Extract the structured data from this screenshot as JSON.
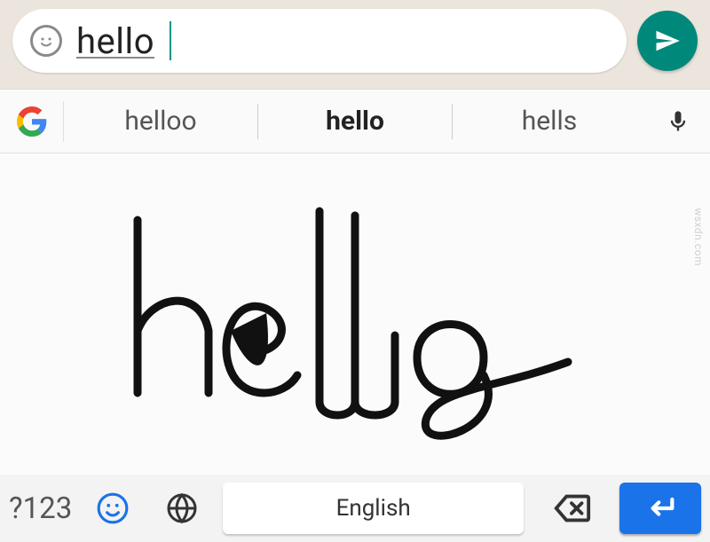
{
  "chat": {
    "message_value": "hello"
  },
  "suggestions": {
    "items": [
      "helloo",
      "hello",
      "hells"
    ],
    "highlighted_index": 1
  },
  "bottom_bar": {
    "symbols_label": "?123",
    "space_label": "English"
  },
  "icons": {
    "emoji": "emoji-icon",
    "send": "send-icon",
    "google": "google-logo-icon",
    "mic": "mic-icon",
    "globe": "globe-icon",
    "backspace": "backspace-icon",
    "enter": "enter-icon"
  },
  "watermark": "wsxdn.com",
  "colors": {
    "accent_teal": "#00897b",
    "chat_bg": "#ece5dd",
    "keyboard_bg": "#fafafa",
    "enter_blue": "#1a73e8"
  }
}
